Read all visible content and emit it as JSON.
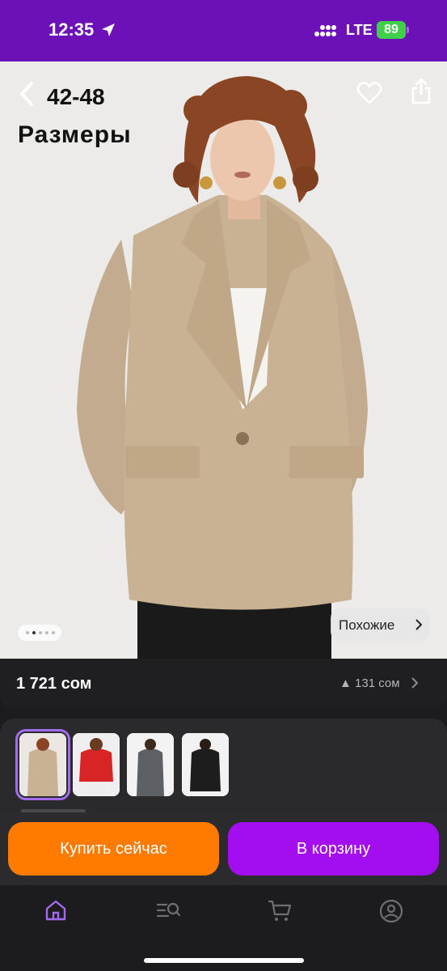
{
  "status_bar": {
    "time": "12:35",
    "network": "LTE",
    "battery": "89"
  },
  "hero": {
    "overlay_size_range": "42-48",
    "overlay_size_word": "Размеры",
    "similar_label": "Похожие"
  },
  "price": {
    "current": "1 721 сом",
    "change": "▲ 131 сом"
  },
  "variants": [
    "beige",
    "red",
    "grey",
    "black"
  ],
  "actions": {
    "buy_now": "Купить сейчас",
    "add_to_cart": "В корзину"
  },
  "tabs": [
    "home-icon",
    "search-list-icon",
    "cart-icon",
    "profile-icon"
  ],
  "colors": {
    "brand": "#6c11b8",
    "buy": "#ff7b00",
    "cart": "#a20ef0",
    "selected": "#a26bf0"
  }
}
